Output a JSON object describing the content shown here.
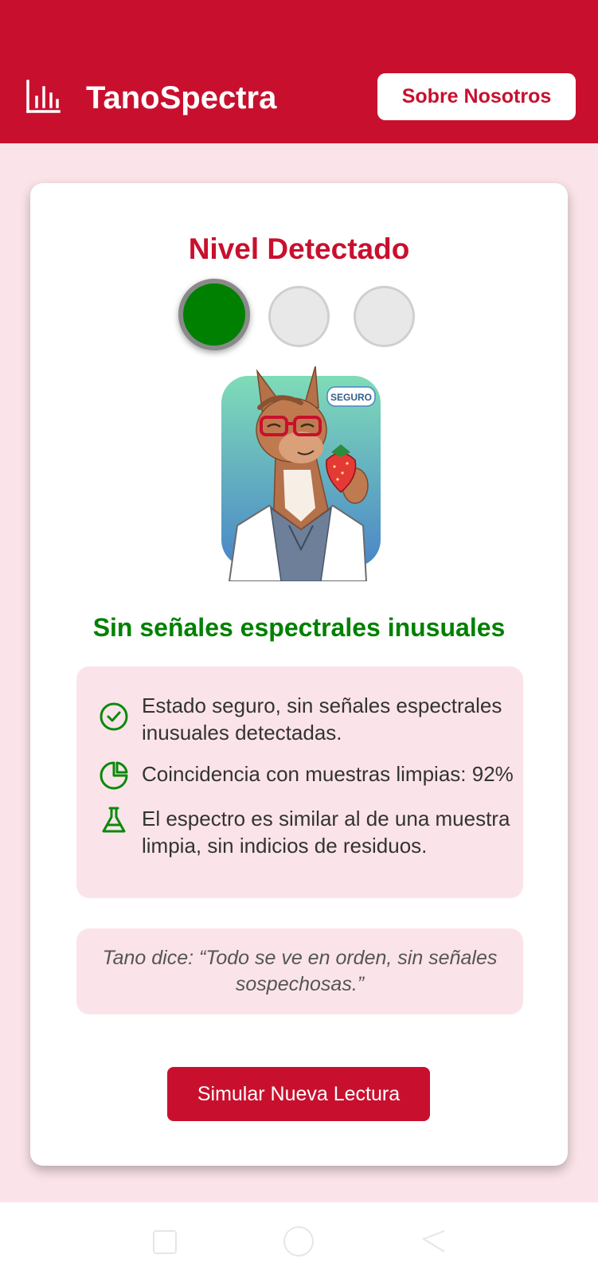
{
  "header": {
    "title": "TanoSpectra",
    "logo_icon": "bar-chart-icon",
    "about_button": "Sobre Nosotros",
    "background": "#c8102e"
  },
  "card": {
    "title": "Nivel Detectado",
    "lights": [
      {
        "state": "on",
        "color": "#008000"
      },
      {
        "state": "off",
        "color": "#e8e8e8"
      },
      {
        "state": "off",
        "color": "#e8e8e8"
      }
    ],
    "mascot_badge": "SEGURO",
    "status": "Sin señales espectrales inusuales",
    "status_color": "#008000",
    "info": [
      {
        "icon": "check-circle-icon",
        "text": "Estado seguro, sin señales espectrales inusuales detectadas."
      },
      {
        "icon": "pie-chart-icon",
        "text": "Coincidencia con muestras limpias: 92%"
      },
      {
        "icon": "flask-icon",
        "text": "El espectro es similar al de una muestra limpia, sin indicios de residuos."
      }
    ],
    "quote": "Tano dice: “Todo se ve en orden, sin señales sospechosas.”",
    "simulate_button": "Simular Nueva Lectura"
  },
  "navbar": {
    "icons": [
      "square-nav-icon",
      "home-circle-nav-icon",
      "back-triangle-nav-icon"
    ]
  }
}
